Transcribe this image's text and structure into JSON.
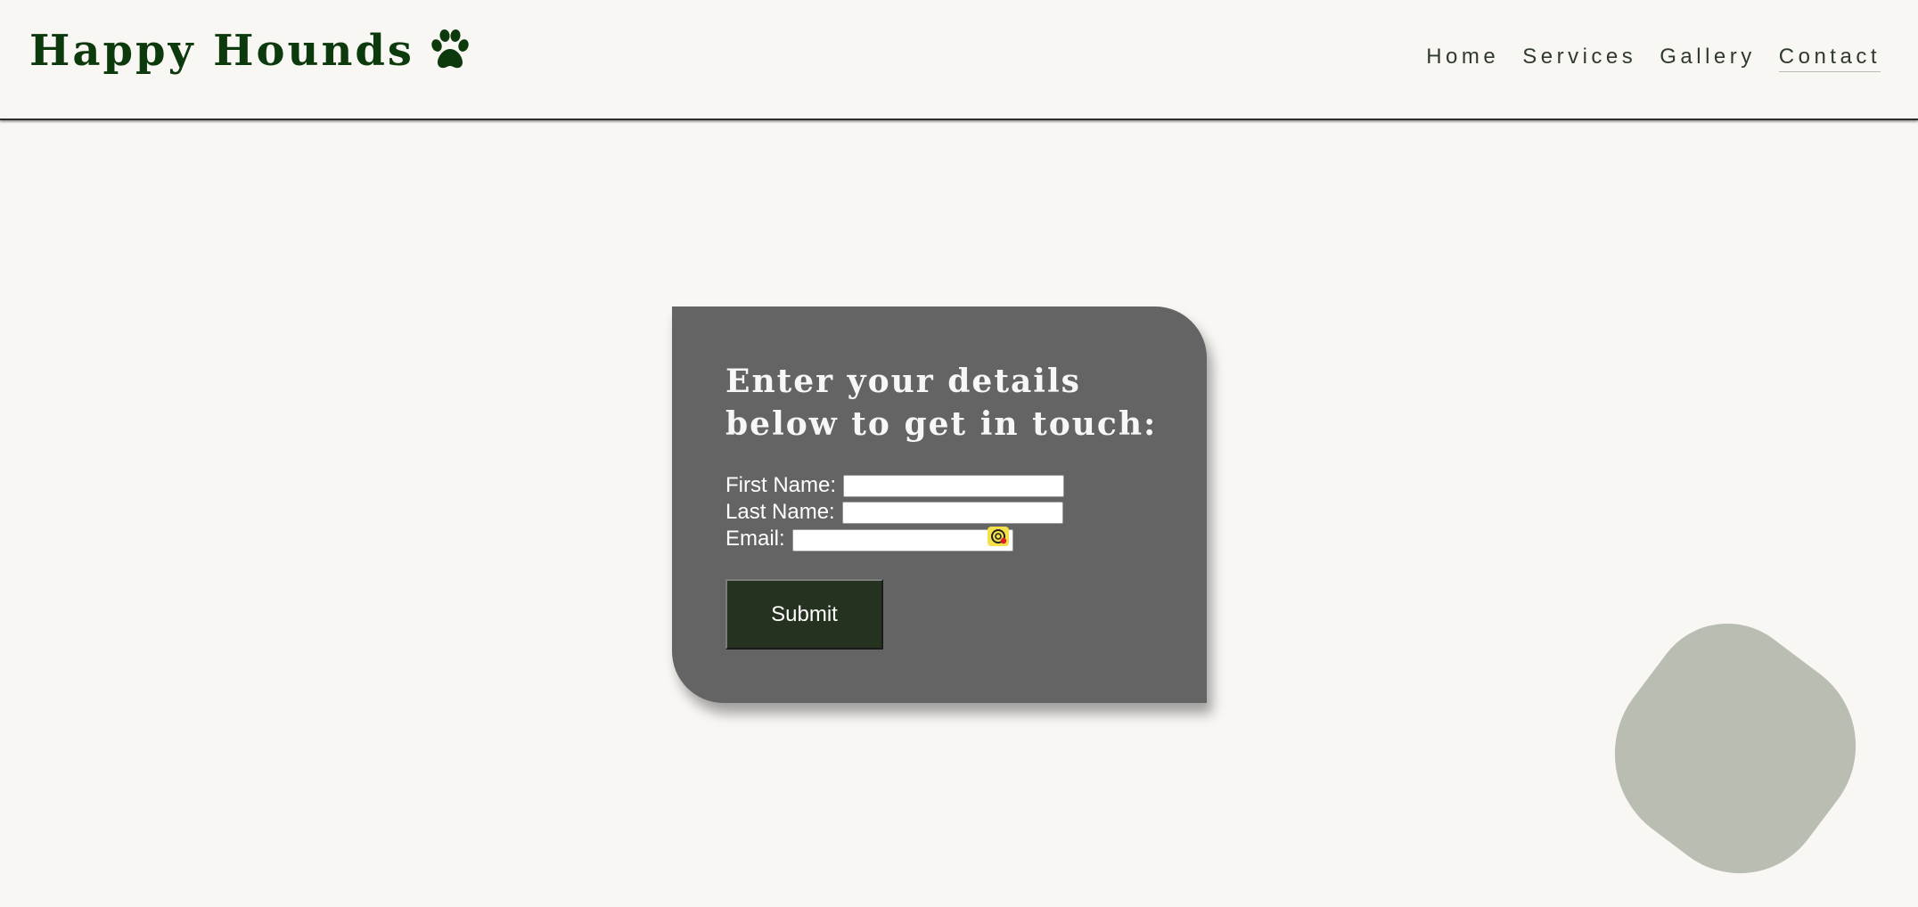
{
  "site": {
    "brand": "Happy Hounds",
    "brand_icon": "paw-icon",
    "colors": {
      "background": "#f9f7f4",
      "brand_green": "#0d3a0d",
      "card": "#646464",
      "submit": "#263220",
      "decoration": "#b9bdb2"
    }
  },
  "nav": {
    "items": [
      {
        "label": "Home"
      },
      {
        "label": "Services"
      },
      {
        "label": "Gallery"
      },
      {
        "label": "Contact"
      }
    ],
    "active": "Contact"
  },
  "form": {
    "title": "Enter your details below to get in touch:",
    "first_name_label": "First Name:",
    "first_name_value": "",
    "last_name_label": "Last Name:",
    "last_name_value": "",
    "email_label": "Email:",
    "email_value": "",
    "email_icon": "autofill-icon",
    "submit_label": "Submit"
  }
}
